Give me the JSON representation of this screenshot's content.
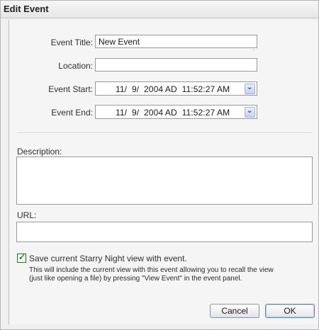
{
  "window": {
    "title": "Edit Event"
  },
  "form": {
    "event_title": {
      "label": "Event Title:",
      "value": "New Event"
    },
    "location": {
      "label": "Location:",
      "value": ""
    },
    "event_start": {
      "label": "Event Start:",
      "value": "11/  9/  2004 AD  11:52:27 AM"
    },
    "event_end": {
      "label": "Event End:",
      "value": "11/  9/  2004 AD  11:52:27 AM"
    },
    "description": {
      "label": "Description:",
      "value": ""
    },
    "url": {
      "label": "URL:",
      "value": ""
    },
    "save_view": {
      "checked": true,
      "label": "Save current Starry Night view with event.",
      "note": "This will include the current view with this event allowing you to recall the view (just like opening a file) by pressing \"View Event\" in the event panel."
    }
  },
  "buttons": {
    "cancel": "Cancel",
    "ok": "OK"
  },
  "icons": {
    "dropdown": "chevron-down-icon",
    "check": "checkmark-icon"
  },
  "colors": {
    "accent": "#5a86d8",
    "check": "#1e8a1e"
  }
}
